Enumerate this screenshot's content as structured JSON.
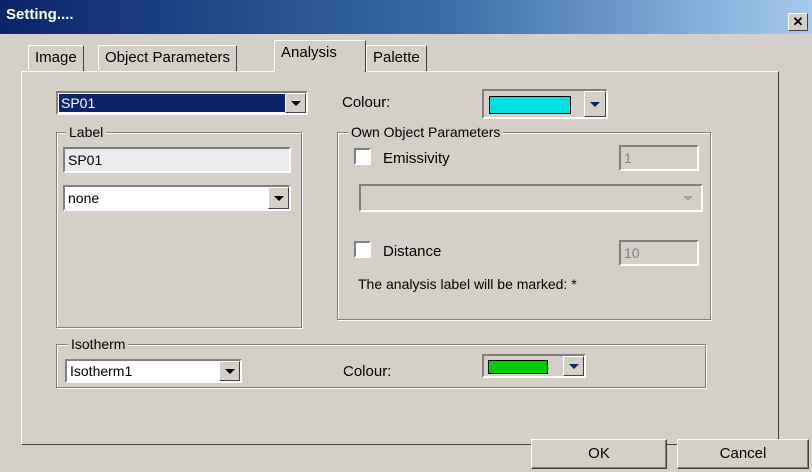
{
  "window": {
    "title": "Setting...."
  },
  "tabs": [
    {
      "label": "Image"
    },
    {
      "label": "Object Parameters"
    },
    {
      "label": "Analysis"
    },
    {
      "label": "Palette"
    }
  ],
  "analysis": {
    "object_select": {
      "value": "SP01"
    },
    "colour": {
      "label": "Colour:",
      "value_color": "#00e0e0"
    },
    "label_group": {
      "title": "Label",
      "name_value": "SP01",
      "type_select": "none"
    },
    "own_params": {
      "title": "Own Object Parameters",
      "emissivity": {
        "label": "Emissivity",
        "checked": false,
        "value": "1"
      },
      "material_select": "",
      "distance": {
        "label": "Distance",
        "checked": false,
        "value": "10"
      },
      "note": "The analysis label will be marked: *"
    },
    "isotherm": {
      "title": "Isotherm",
      "select": "Isotherm1",
      "colour_label": "Colour:",
      "value_color": "#00cc00"
    }
  },
  "buttons": {
    "ok": "OK",
    "cancel": "Cancel"
  },
  "colors": {
    "title_bar": "#0a246a",
    "dialog_face": "#d4d0c8",
    "selection": "#0a246a"
  }
}
